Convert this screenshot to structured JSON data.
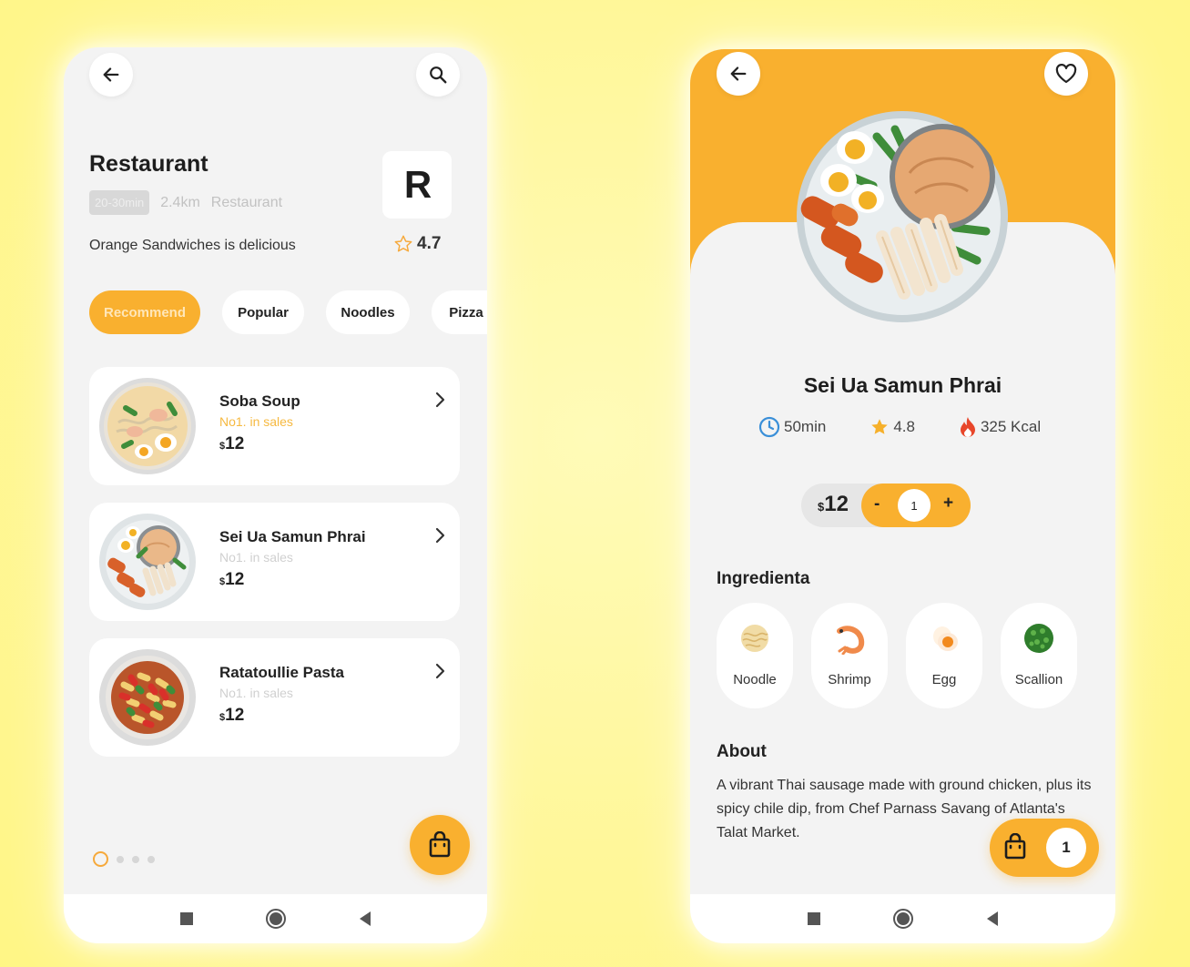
{
  "left_screen": {
    "restaurant_name": "Restaurant",
    "delivery_time": "20-30min",
    "distance": "2.4km",
    "category": "Restaurant",
    "description": "Orange Sandwiches is delicious",
    "rating": "4.7",
    "logo_letter": "R",
    "tabs": [
      {
        "label": "Recommend",
        "active": true
      },
      {
        "label": "Popular",
        "active": false
      },
      {
        "label": "Noodles",
        "active": false
      },
      {
        "label": "Pizza",
        "active": false
      }
    ],
    "dishes": [
      {
        "name": "Soba Soup",
        "rank": "No1. in sales",
        "currency": "$",
        "price": "12",
        "highlight": true
      },
      {
        "name": "Sei Ua Samun Phrai",
        "rank": "No1. in sales",
        "currency": "$",
        "price": "12",
        "highlight": false
      },
      {
        "name": "Ratatoullie Pasta",
        "rank": "No1. in sales",
        "currency": "$",
        "price": "12",
        "highlight": false
      }
    ],
    "page_dots": {
      "count": 4,
      "active_index": 0
    }
  },
  "right_screen": {
    "dish_name": "Sei Ua Samun Phrai",
    "time": "50min",
    "rating": "4.8",
    "calories": "325 Kcal",
    "currency": "$",
    "price": "12",
    "stepper": {
      "minus": "-",
      "quantity": "1",
      "plus": "+"
    },
    "ingredients_title": "Ingredienta",
    "ingredients": [
      {
        "label": "Noodle",
        "icon": "noodle-icon"
      },
      {
        "label": "Shrimp",
        "icon": "shrimp-icon"
      },
      {
        "label": "Egg",
        "icon": "egg-icon"
      },
      {
        "label": "Scallion",
        "icon": "scallion-icon"
      }
    ],
    "about_title": "About",
    "about_text": "A vibrant Thai sausage made with ground chicken, plus its spicy chile dip, from Chef Parnass Savang of Atlanta's Talat Market.",
    "cart_count": "1"
  },
  "colors": {
    "accent": "#f9b02f",
    "background": "#fff79a",
    "screen": "#f3f3f3"
  }
}
